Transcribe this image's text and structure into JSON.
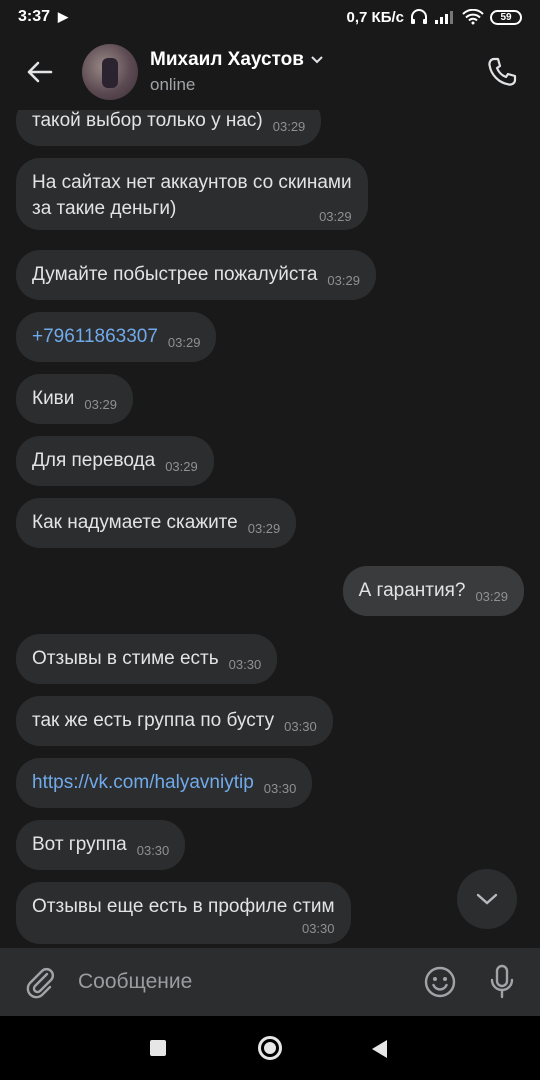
{
  "status_bar": {
    "time": "3:37",
    "network_speed": "0,7 КБ/с",
    "battery_level": "59"
  },
  "header": {
    "name": "Михаил Хаустов",
    "presence": "online"
  },
  "messages": [
    {
      "text": "такой выбор только у нас)",
      "time": "03:29",
      "direction": "in"
    },
    {
      "text_line1": "На сайтах нет аккаунтов со скинами",
      "text_line2": "за такие деньги)",
      "time": "03:29",
      "direction": "in"
    },
    {
      "text": "Думайте побыстрее пожалуйста",
      "time": "03:29",
      "direction": "in"
    },
    {
      "text": "+79611863307",
      "time": "03:29",
      "direction": "in",
      "is_link": true
    },
    {
      "text": "Киви",
      "time": "03:29",
      "direction": "in"
    },
    {
      "text": "Для перевода",
      "time": "03:29",
      "direction": "in"
    },
    {
      "text": "Как надумаете скажите",
      "time": "03:29",
      "direction": "in"
    },
    {
      "text": "А гарантия?",
      "time": "03:29",
      "direction": "out"
    },
    {
      "text": "Отзывы в стиме есть",
      "time": "03:30",
      "direction": "in"
    },
    {
      "text": "так же есть группа по бусту",
      "time": "03:30",
      "direction": "in"
    },
    {
      "text": "https://vk.com/halyavniytip",
      "time": "03:30",
      "direction": "in",
      "is_link": true
    },
    {
      "text": "Вот группа",
      "time": "03:30",
      "direction": "in"
    },
    {
      "text": "Отзывы еще есть в профиле стим",
      "time": "03:30",
      "direction": "in"
    }
  ],
  "composer": {
    "placeholder": "Сообщение"
  },
  "colors": {
    "background": "#191919",
    "bubble_in": "#2c2d2e",
    "bubble_out": "#3a3b3d",
    "link": "#71aaeb",
    "timestamp": "#8d9094"
  },
  "icons": {
    "back": "arrow-left-icon",
    "call": "phone-icon",
    "dropdown": "chevron-down-icon",
    "scroll_down": "chevron-down-icon",
    "attach": "paperclip-icon",
    "emoji": "smiley-icon",
    "mic": "microphone-icon"
  }
}
